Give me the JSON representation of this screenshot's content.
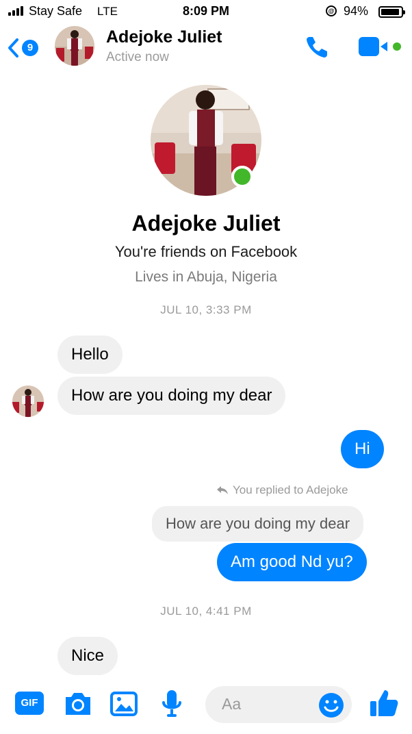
{
  "status_bar": {
    "carrier": "Stay Safe",
    "network": "LTE",
    "time": "8:09 PM",
    "lock_symbol": "@",
    "battery_percent": "94%",
    "battery_level": 0.94
  },
  "header": {
    "unread_count": "9",
    "contact_name": "Adejoke Juliet",
    "presence": "Active now",
    "icons": [
      "back-chevron-icon",
      "phone-icon",
      "video-camera-icon"
    ]
  },
  "profile": {
    "name": "Adejoke Juliet",
    "relation": "You're friends on Facebook",
    "location": "Lives in Abuja, Nigeria"
  },
  "conversation": {
    "timestamp_1": "JUL 10, 3:33 PM",
    "incoming_1": "Hello",
    "incoming_2": "How are you doing my dear",
    "outgoing_1": "Hi",
    "reply_note": "You replied to Adejoke",
    "quoted_message": "How are you doing my dear",
    "outgoing_2": "Am good Nd yu?",
    "timestamp_2": "JUL 10, 4:41 PM",
    "incoming_3": "Nice"
  },
  "composer": {
    "gif_label": "GIF",
    "placeholder": "Aa",
    "icons": [
      "gif-icon",
      "camera-icon",
      "photo-icon",
      "microphone-icon",
      "emoji-icon",
      "thumbs-up-icon"
    ]
  },
  "colors": {
    "accent": "#0084ff",
    "online": "#42b72a",
    "bubble_in": "#f1f0f0"
  }
}
